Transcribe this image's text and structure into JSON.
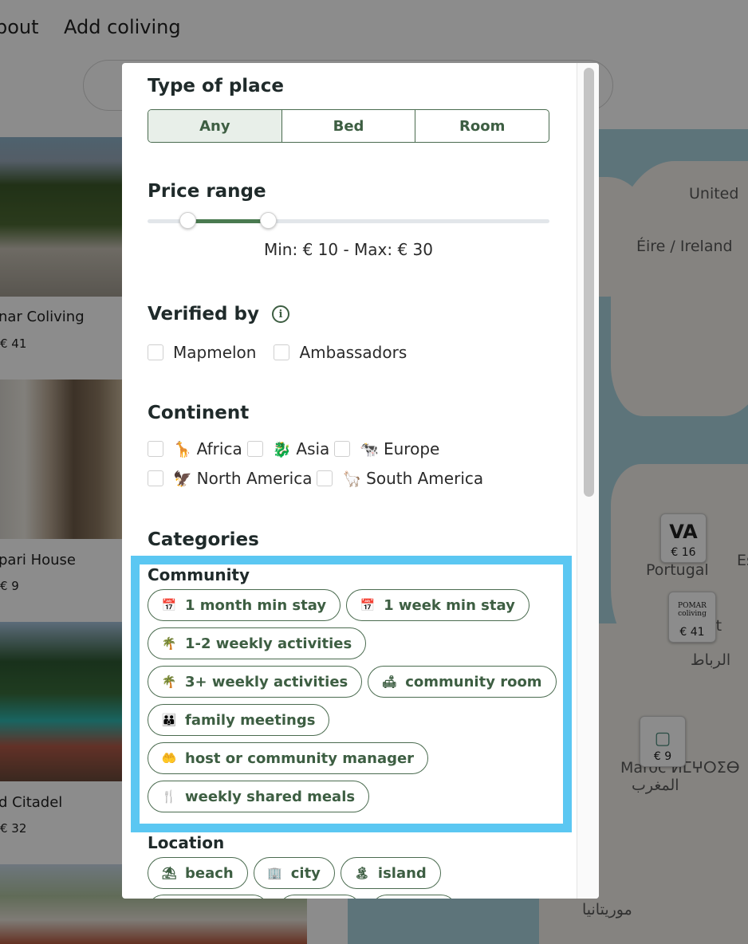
{
  "nav": {
    "about": "bout",
    "add": "Add coliving"
  },
  "listings": [
    {
      "title": "nar Coliving",
      "price": "€ 41"
    },
    {
      "title": "pari House",
      "price": "€ 9"
    },
    {
      "title": "d Citadel",
      "price": "€ 32"
    }
  ],
  "map": {
    "labels": {
      "uk": "United",
      "ireland": "Éire / Ireland",
      "portugal": "Portugal",
      "rabat": "الرباط",
      "morocco": "Maroc ⵍⵎⵖⵔⵉⴱ",
      "maghrib": "المغرب",
      "mauritania": "موريتانيا",
      "es": "Es",
      "at": "at",
      "rabat_tif": "ⵔⴱⴰⵟ"
    },
    "markers": [
      {
        "logo": "VA",
        "price": "€ 16"
      },
      {
        "logo": "POMAR coliving",
        "price": "€ 41"
      },
      {
        "logo": "▢",
        "price": "€ 9"
      }
    ]
  },
  "filters": {
    "type_of_place": {
      "title": "Type of place",
      "options": [
        "Any",
        "Bed",
        "Room"
      ],
      "selected": "Any"
    },
    "price_range": {
      "title": "Price range",
      "min": 10,
      "max": 30,
      "text": "Min: € 10 - Max: € 30"
    },
    "verified_by": {
      "title": "Verified by",
      "info_icon": "i",
      "options": [
        "Mapmelon",
        "Ambassadors"
      ]
    },
    "continent": {
      "title": "Continent",
      "options": [
        {
          "emoji": "🦒",
          "label": "Africa"
        },
        {
          "emoji": "🐉",
          "label": "Asia"
        },
        {
          "emoji": "🐄",
          "label": "Europe"
        },
        {
          "emoji": "🦅",
          "label": "North America"
        },
        {
          "emoji": "🦙",
          "label": "South America"
        }
      ]
    },
    "categories": {
      "title": "Categories",
      "community": {
        "title": "Community",
        "chips": [
          {
            "icon": "calendar-icon",
            "glyph": "📅",
            "label": "1 month min stay"
          },
          {
            "icon": "calendar-icon",
            "glyph": "📅",
            "label": "1 week min stay"
          },
          {
            "icon": "activity-icon",
            "glyph": "🌴",
            "label": "1-2 weekly activities"
          },
          {
            "icon": "activity-icon",
            "glyph": "🌴",
            "label": "3+ weekly activities"
          },
          {
            "icon": "sofa-icon",
            "glyph": "🛋",
            "label": "community room"
          },
          {
            "icon": "people-icon",
            "glyph": "👪",
            "label": "family meetings"
          },
          {
            "icon": "hand-heart-icon",
            "glyph": "🤲",
            "label": "host or community manager"
          },
          {
            "icon": "utensils-icon",
            "glyph": "🍴",
            "label": "weekly shared meals"
          }
        ]
      },
      "location": {
        "title": "Location",
        "chips": [
          {
            "icon": "beach-umbrella-icon",
            "glyph": "⛱",
            "label": "beach"
          },
          {
            "icon": "buildings-icon",
            "glyph": "🏢",
            "label": "city"
          },
          {
            "icon": "island-icon",
            "glyph": "🏝",
            "label": "island"
          }
        ]
      }
    }
  }
}
